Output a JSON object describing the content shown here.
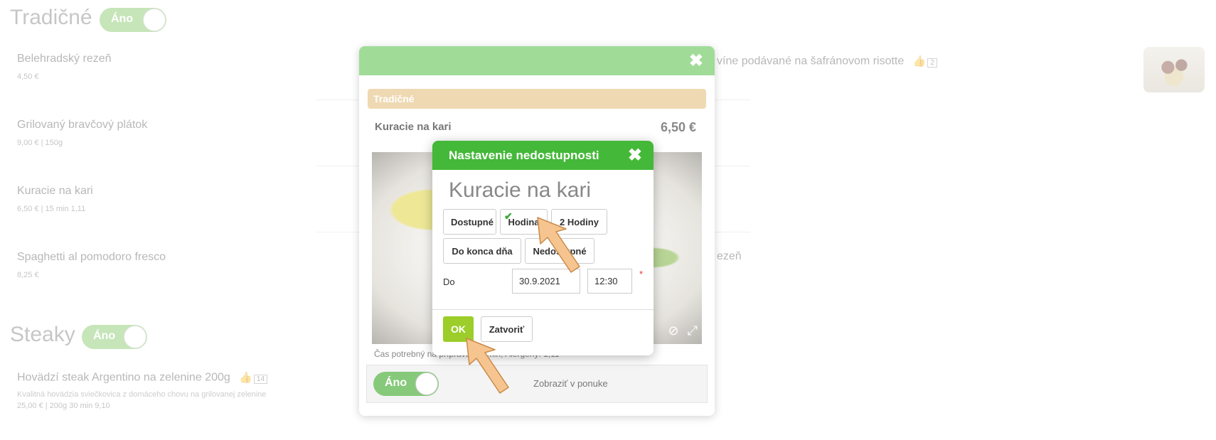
{
  "background": {
    "categories": [
      {
        "title": "Tradičné",
        "toggle": "Áno"
      },
      {
        "title": "Steaky",
        "toggle": "Áno"
      }
    ],
    "items": [
      {
        "name": "Belehradský rezeň",
        "meta": "4,50 €"
      },
      {
        "name": "Grilovaný bravčový plátok",
        "meta": "9,00 €  |  150g"
      },
      {
        "name": "Kuracie na kari",
        "meta": "6,50 €  |  15 min  1,11"
      },
      {
        "name": "Spaghetti al pomodoro fresco",
        "meta": "8,25 €"
      },
      {
        "name": "Hovädzí steak Argentino na zelenine 200g",
        "likes": "14",
        "desc": "Kvalitná hovädzia sviečkovica z domáceho chovu na grilovanej zelenine",
        "meta": "25,00 €  |  200g  30 min  9,10"
      }
    ],
    "right_item_text": "víne podávané na šafránovom risotte",
    "right_item_likes": "2",
    "right_partial_text": "ezeň"
  },
  "modal": {
    "category": "Tradičné",
    "dish_name": "Kuracie na kari",
    "price": "6,50 €",
    "note": "Čas potrebný na prípravu: 15 min, Alergény: 1,11",
    "toggle_label": "Áno",
    "show_label": "Zobraziť v ponuke"
  },
  "dialog": {
    "title": "Nastavenie nedostupnosti",
    "dish": "Kuracie na kari",
    "options": [
      "Dostupné",
      "Hodina",
      "2 Hodiny",
      "Do konca dňa",
      "Nedostupné"
    ],
    "selected_option": "Hodina",
    "until_label": "Do",
    "date": "30.9.2021",
    "time": "12:30",
    "required_mark": "*",
    "ok_label": "OK",
    "close_label": "Zatvoriť"
  },
  "colors": {
    "modal_header": "#a0dc98",
    "dialog_header": "#44b838",
    "ok_button": "#9ccd2a",
    "category_bar": "#efd9b2"
  },
  "icons": [
    "close-icon",
    "thumbs-up-icon",
    "checkmark-icon",
    "fullscreen-icon",
    "pointer-arrow-icon"
  ]
}
